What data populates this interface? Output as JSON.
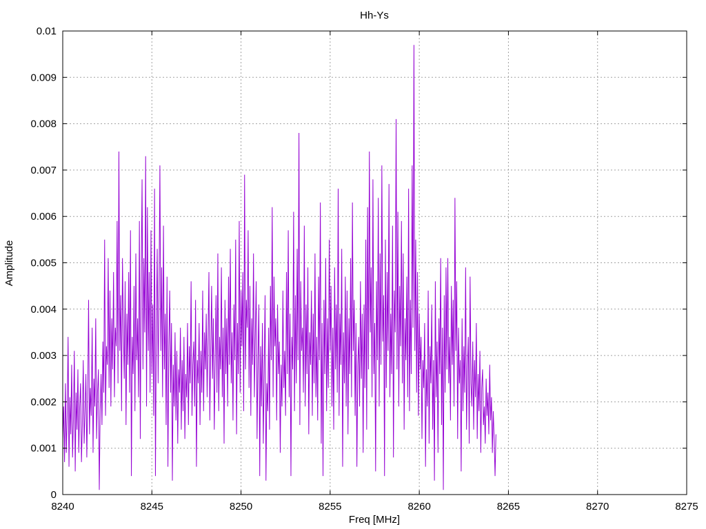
{
  "chart_data": {
    "type": "line",
    "title": "Hh-Ys",
    "xlabel": "Freq [MHz]",
    "ylabel": "Amplitude",
    "xlim": [
      8240,
      8275
    ],
    "ylim": [
      0,
      0.01
    ],
    "x_ticks": [
      "8240",
      "8245",
      "8250",
      "8255",
      "8260",
      "8265",
      "8270",
      "8275"
    ],
    "y_ticks": [
      "0",
      "0.001",
      "0.002",
      "0.003",
      "0.004",
      "0.005",
      "0.006",
      "0.007",
      "0.008",
      "0.009",
      "0.01"
    ],
    "grid": true,
    "series": [
      {
        "color": "#9400d3",
        "x_start": 8240.0,
        "x_step": 0.05,
        "values": [
          0.0012,
          0.0019,
          0.0007,
          0.0024,
          0.0009,
          0.0017,
          0.0034,
          0.0006,
          0.0021,
          0.0013,
          0.0028,
          0.0008,
          0.0016,
          0.0031,
          0.0005,
          0.0022,
          0.0014,
          0.0027,
          0.0009,
          0.0019,
          0.0024,
          0.0007,
          0.0015,
          0.0029,
          0.0011,
          0.0018,
          0.0026,
          0.0008,
          0.0021,
          0.0042,
          0.0013,
          0.0023,
          0.0017,
          0.0036,
          0.0009,
          0.0025,
          0.0019,
          0.0038,
          0.0012,
          0.0022,
          0.0027,
          0.0001,
          0.0018,
          0.0026,
          0.0015,
          0.0033,
          0.0022,
          0.0055,
          0.0017,
          0.0032,
          0.0028,
          0.0051,
          0.0023,
          0.0044,
          0.0019,
          0.0038,
          0.0027,
          0.0048,
          0.0021,
          0.0036,
          0.0032,
          0.0059,
          0.0024,
          0.0074,
          0.0031,
          0.0043,
          0.0018,
          0.0051,
          0.0036,
          0.0025,
          0.0046,
          0.0015,
          0.0039,
          0.0028,
          0.0048,
          0.0022,
          0.0057,
          0.0004,
          0.0034,
          0.0026,
          0.0045,
          0.0018,
          0.0052,
          0.0029,
          0.0038,
          0.0021,
          0.0059,
          0.0012,
          0.0046,
          0.0068,
          0.0027,
          0.0051,
          0.0035,
          0.0073,
          0.0019,
          0.0062,
          0.0031,
          0.0048,
          0.0022,
          0.0057,
          0.0026,
          0.0041,
          0.0017,
          0.0066,
          0.0004,
          0.0036,
          0.0053,
          0.0024,
          0.0044,
          0.0071,
          0.0031,
          0.0049,
          0.0021,
          0.0058,
          0.0027,
          0.0039,
          0.0015,
          0.0047,
          0.0006,
          0.0032,
          0.0044,
          0.0022,
          0.0037,
          0.0003,
          0.0028,
          0.0019,
          0.0035,
          0.0016,
          0.0031,
          0.0011,
          0.0027,
          0.0022,
          0.0036,
          0.0014,
          0.0029,
          0.0018,
          0.0034,
          0.0012,
          0.0026,
          0.0021,
          0.0037,
          0.0015,
          0.0032,
          0.0024,
          0.0046,
          0.0017,
          0.0028,
          0.0033,
          0.0019,
          0.0042,
          0.0006,
          0.0029,
          0.0024,
          0.0037,
          0.0015,
          0.0031,
          0.0022,
          0.0044,
          0.0018,
          0.0035,
          0.0027,
          0.0039,
          0.0021,
          0.0034,
          0.0048,
          0.0016,
          0.0031,
          0.0045,
          0.0025,
          0.0038,
          0.0014,
          0.0029,
          0.0043,
          0.0022,
          0.0052,
          0.0018,
          0.0034,
          0.0027,
          0.0049,
          0.0021,
          0.0036,
          0.0011,
          0.0042,
          0.0026,
          0.0038,
          0.0019,
          0.0047,
          0.0028,
          0.0053,
          0.0024,
          0.0035,
          0.0016,
          0.0041,
          0.0029,
          0.0055,
          0.0013,
          0.0037,
          0.0026,
          0.0059,
          0.0022,
          0.0044,
          0.0032,
          0.0048,
          0.0018,
          0.0069,
          0.0027,
          0.0042,
          0.0036,
          0.0057,
          0.0023,
          0.0045,
          0.0017,
          0.0038,
          0.0028,
          0.0052,
          0.0021,
          0.0034,
          0.0046,
          0.0012,
          0.0029,
          0.0041,
          0.0004,
          0.0032,
          0.0019,
          0.0037,
          0.0011,
          0.0027,
          0.0043,
          0.0003,
          0.0024,
          0.0018,
          0.0036,
          0.0014,
          0.0045,
          0.0029,
          0.0062,
          0.0021,
          0.0047,
          0.0032,
          0.0038,
          0.0016,
          0.0041,
          0.0026,
          0.0033,
          0.0009,
          0.0028,
          0.0019,
          0.0044,
          0.0023,
          0.0031,
          0.0017,
          0.0048,
          0.0026,
          0.0057,
          0.0021,
          0.0039,
          0.0004,
          0.0034,
          0.0027,
          0.0061,
          0.0018,
          0.0043,
          0.0024,
          0.0053,
          0.0029,
          0.0078,
          0.0015,
          0.0046,
          0.0031,
          0.0036,
          0.0022,
          0.0058,
          0.0019,
          0.0041,
          0.0026,
          0.0049,
          0.0013,
          0.0035,
          0.0028,
          0.0044,
          0.0017,
          0.0039,
          0.0024,
          0.0052,
          0.0021,
          0.0034,
          0.0016,
          0.0047,
          0.0029,
          0.0063,
          0.0011,
          0.0037,
          0.0004,
          0.0042,
          0.0026,
          0.0051,
          0.0018,
          0.0038,
          0.0023,
          0.0055,
          0.0031,
          0.0045,
          0.0019,
          0.0036,
          0.0014,
          0.0049,
          0.0027,
          0.0041,
          0.0022,
          0.0066,
          0.0017,
          0.0039,
          0.0028,
          0.0053,
          0.0006,
          0.0035,
          0.0024,
          0.0047,
          0.0019,
          0.0044,
          0.0013,
          0.0038,
          0.0026,
          0.0051,
          0.0021,
          0.0063,
          0.0031,
          0.0042,
          0.0017,
          0.0037,
          0.0006,
          0.0028,
          0.0034,
          0.0019,
          0.0046,
          0.0025,
          0.0039,
          0.0009,
          0.0041,
          0.0023,
          0.0055,
          0.0014,
          0.0062,
          0.0027,
          0.0074,
          0.0035,
          0.0049,
          0.0021,
          0.0068,
          0.0026,
          0.0037,
          0.0005,
          0.0046,
          0.0029,
          0.0064,
          0.0019,
          0.0052,
          0.0028,
          0.0071,
          0.0033,
          0.0043,
          0.0004,
          0.0055,
          0.0023,
          0.0048,
          0.0031,
          0.0067,
          0.0021,
          0.0039,
          0.0026,
          0.0058,
          0.0008,
          0.0044,
          0.0035,
          0.0081,
          0.0027,
          0.0061,
          0.0019,
          0.0045,
          0.0032,
          0.0059,
          0.0024,
          0.0052,
          0.0014,
          0.0038,
          0.0029,
          0.0047,
          0.0021,
          0.0066,
          0.0018,
          0.0042,
          0.0026,
          0.0071,
          0.0036,
          0.0097,
          0.0031,
          0.0055,
          0.0022,
          0.0048,
          0.0017,
          0.0039,
          0.0027,
          0.0034,
          0.0012,
          0.0029,
          0.0023,
          0.0037,
          0.0006,
          0.0027,
          0.0019,
          0.0044,
          0.0011,
          0.0032,
          0.0024,
          0.0041,
          0.0014,
          0.0029,
          0.0003,
          0.0046,
          0.0021,
          0.0033,
          0.0009,
          0.0038,
          0.0026,
          0.0051,
          0.0015,
          0.0036,
          0.0001,
          0.0043,
          0.0022,
          0.0049,
          0.0027,
          0.0051,
          0.0024,
          0.0034,
          0.0016,
          0.0045,
          0.0028,
          0.0042,
          0.0019,
          0.0064,
          0.0031,
          0.0046,
          0.0012,
          0.0036,
          0.0024,
          0.0029,
          0.0005,
          0.0038,
          0.0018,
          0.0032,
          0.0022,
          0.0049,
          0.0014,
          0.0027,
          0.0034,
          0.0011,
          0.0047,
          0.0024,
          0.0019,
          0.0033,
          0.0014,
          0.0029,
          0.0021,
          0.0037,
          0.0012,
          0.0026,
          0.0018,
          0.0031,
          0.0009,
          0.0023,
          0.0027,
          0.0015,
          0.0019,
          0.0011,
          0.0025,
          0.0017,
          0.0022,
          0.0013,
          0.0028,
          0.0016,
          0.0021,
          0.0009,
          0.0018,
          0.0012,
          0.0004,
          0.0013
        ]
      }
    ]
  }
}
